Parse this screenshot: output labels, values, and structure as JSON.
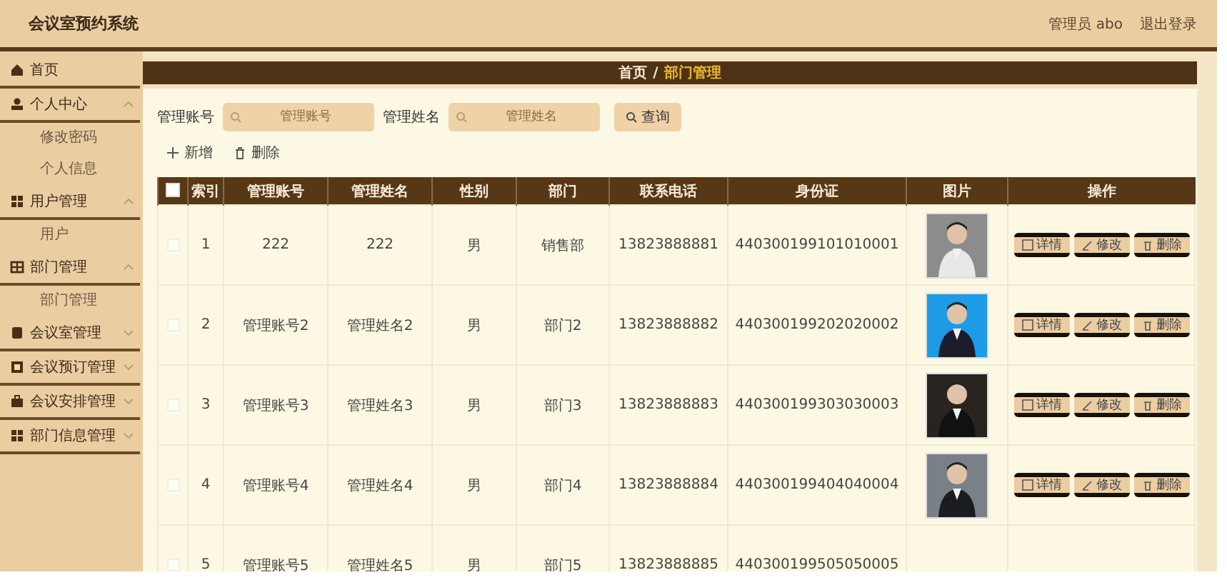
{
  "header": {
    "title": "会议室预约系统",
    "user": "管理员 abo",
    "logout": "退出登录"
  },
  "sidebar": {
    "items": [
      {
        "label": "首页"
      },
      {
        "label": "个人中心",
        "expanded": true,
        "children": [
          {
            "label": "修改密码"
          },
          {
            "label": "个人信息"
          }
        ]
      },
      {
        "label": "用户管理",
        "expanded": true,
        "children": [
          {
            "label": "用户"
          }
        ]
      },
      {
        "label": "部门管理",
        "expanded": true,
        "children": [
          {
            "label": "部门管理"
          }
        ]
      },
      {
        "label": "会议室管理",
        "expanded": false
      },
      {
        "label": "会议预订管理",
        "expanded": false
      },
      {
        "label": "会议安排管理",
        "expanded": false
      },
      {
        "label": "部门信息管理",
        "expanded": false
      }
    ]
  },
  "breadcrumb": [
    {
      "label": "首页",
      "current": false
    },
    {
      "label": "部门管理",
      "current": true
    }
  ],
  "breadcrumb_separator": "/",
  "search": {
    "fields": [
      {
        "label": "管理账号",
        "placeholder": "管理账号"
      },
      {
        "label": "管理姓名",
        "placeholder": "管理姓名"
      }
    ],
    "button": "查询"
  },
  "actions": [
    {
      "label": "新增"
    },
    {
      "label": "删除"
    }
  ],
  "table": {
    "select_all": {
      "checked": false
    },
    "columns": [
      "索引",
      "管理账号",
      "管理姓名",
      "性别",
      "部门",
      "联系电话",
      "身份证",
      "图片",
      "操作"
    ],
    "rows": [
      {
        "checked": false,
        "index": "1",
        "account": "222",
        "name": "222",
        "gender": "男",
        "department": "销售部",
        "phone": "13823888881",
        "id_card": "440300199101010001",
        "buttons": [
          "详情",
          "修改",
          "删除"
        ]
      },
      {
        "checked": false,
        "index": "2",
        "account": "管理账号2",
        "name": "管理姓名2",
        "gender": "男",
        "department": "部门2",
        "phone": "13823888882",
        "id_card": "440300199202020002",
        "buttons": [
          "详情",
          "修改",
          "删除"
        ]
      },
      {
        "checked": false,
        "index": "3",
        "account": "管理账号3",
        "name": "管理姓名3",
        "gender": "男",
        "department": "部门3",
        "phone": "13823888883",
        "id_card": "440300199303030003",
        "buttons": [
          "详情",
          "修改",
          "删除"
        ]
      },
      {
        "checked": false,
        "index": "4",
        "account": "管理账号4",
        "name": "管理姓名4",
        "gender": "男",
        "department": "部门4",
        "phone": "13823888884",
        "id_card": "440300199404040004",
        "buttons": [
          "详情",
          "修改",
          "删除"
        ]
      },
      {
        "checked": false,
        "index": "5",
        "account": "管理账号5",
        "name": "管理姓名5",
        "gender": "男",
        "department": "部门5",
        "phone": "13823888885",
        "id_card": "440300199505050005"
      }
    ]
  }
}
